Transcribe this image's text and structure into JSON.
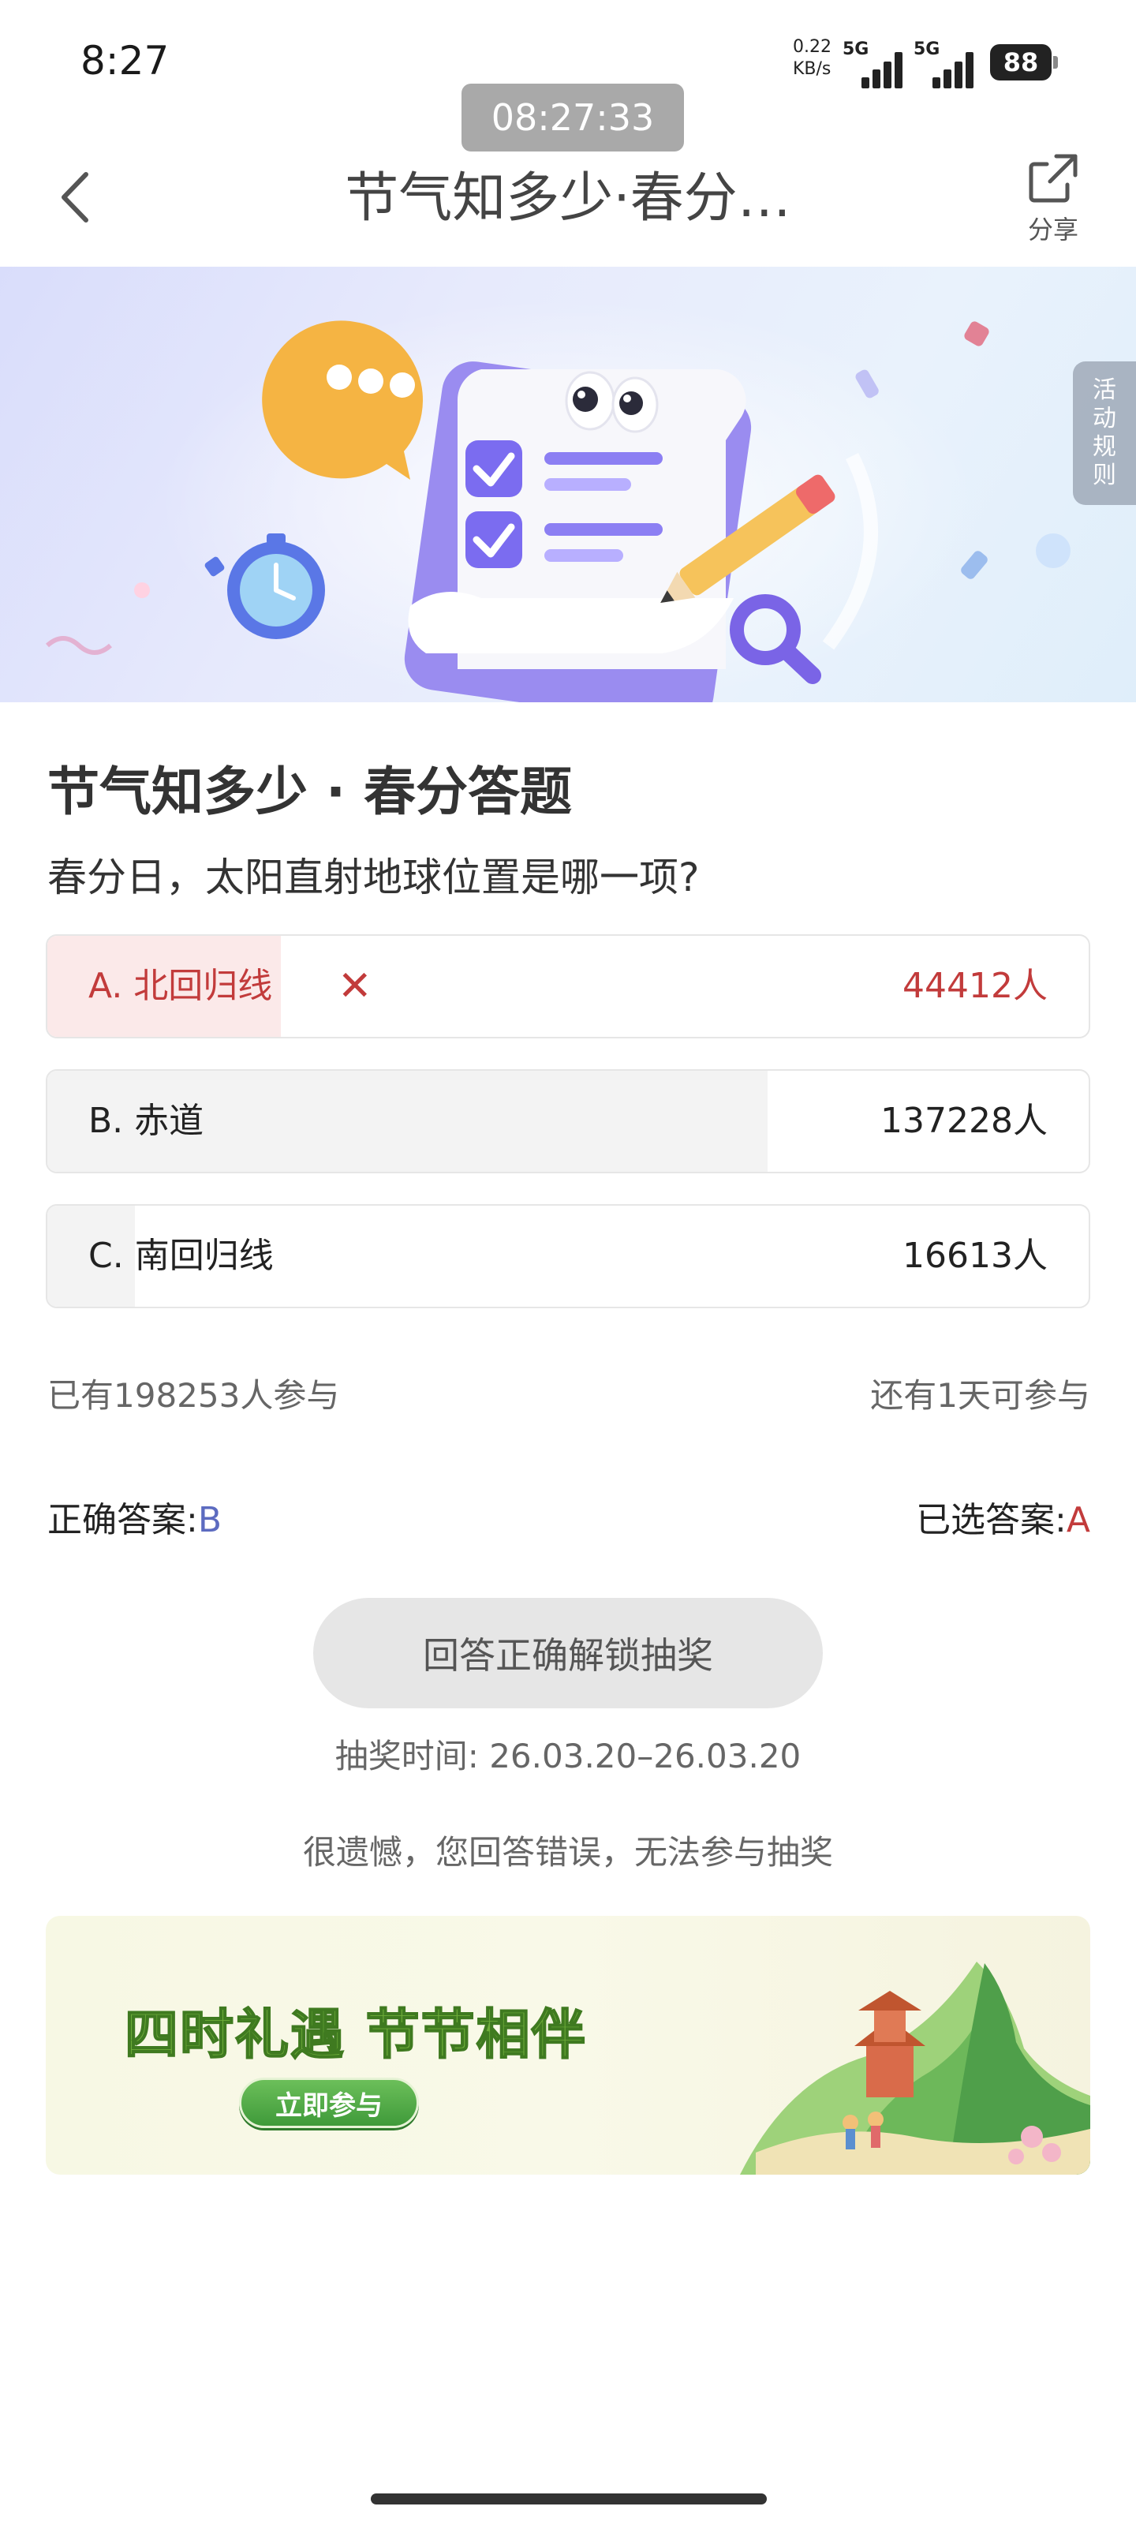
{
  "status_bar": {
    "time": "8:27",
    "net_speed_value": "0.22",
    "net_speed_unit": "KB/s",
    "signal1_label": "5G",
    "signal2_label": "5G",
    "battery": "88"
  },
  "timer": "08:27:33",
  "nav": {
    "title": "节气知多少·春分…",
    "share_label": "分享"
  },
  "banner": {
    "rules_tab": [
      "活",
      "动",
      "规",
      "则"
    ]
  },
  "quiz": {
    "title": "节气知多少 · 春分答题",
    "question": "春分日，太阳直射地球位置是哪一项?",
    "options": [
      {
        "label": "A. 北回归线",
        "count": "44412人",
        "fraction": 0.224,
        "state": "wrong"
      },
      {
        "label": "B. 赤道",
        "count": "137228人",
        "fraction": 0.692,
        "state": "normal"
      },
      {
        "label": "C. 南回归线",
        "count": "16613人",
        "fraction": 0.084,
        "state": "normal"
      }
    ],
    "participants": "已有198253人参与",
    "remaining": "还有1天可参与",
    "correct_answer_label": "正确答案:",
    "correct_answer_value": "B",
    "chosen_answer_label": "已选答案:",
    "chosen_answer_value": "A",
    "unlock_button": "回答正确解锁抽奖",
    "draw_time": "抽奖时间: 26.03.20–26.03.20",
    "sorry_message": "很遗憾，您回答错误，无法参与抽奖"
  },
  "promo": {
    "slogan": "四时礼遇 节节相伴",
    "button": "立即参与"
  },
  "colors": {
    "wrong": "#c23b3b",
    "correct": "#5c6bc0",
    "promo_green": "#6fae3a"
  }
}
